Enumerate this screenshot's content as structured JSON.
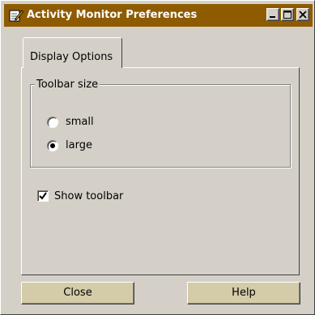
{
  "window": {
    "title": "Activity Monitor Preferences",
    "icon": "edit-pencil-icon",
    "controls": [
      "minimize-icon",
      "maximize-icon",
      "close-icon"
    ],
    "title_color": "#8e5b00"
  },
  "tabs": [
    {
      "label": "Display Options",
      "selected": true
    }
  ],
  "toolbar_size": {
    "group_label": "Toolbar size",
    "options": [
      {
        "label": "small",
        "selected": false
      },
      {
        "label": "large",
        "selected": true
      }
    ]
  },
  "show_toolbar": {
    "label": "Show toolbar",
    "checked": true
  },
  "buttons": {
    "close": "Close",
    "help": "Help"
  },
  "colors": {
    "button_face": "#d4cba8",
    "dialog_bg": "#d4d0c8"
  }
}
